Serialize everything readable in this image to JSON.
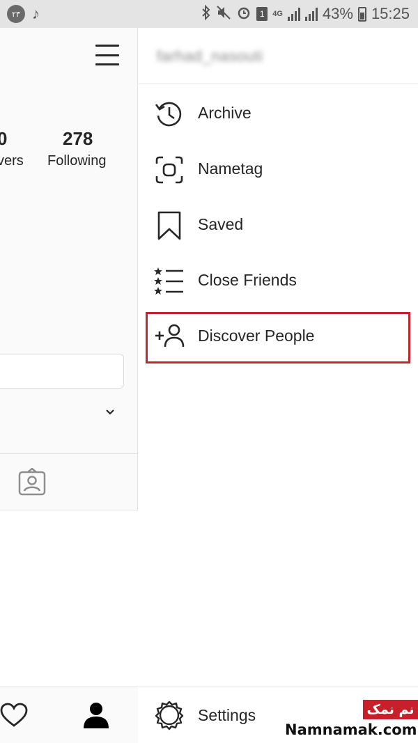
{
  "status_bar": {
    "left_badge": "۲۳",
    "sim": "1",
    "network": "4G",
    "battery_percent": "43%",
    "time": "15:25"
  },
  "profile": {
    "followers_count": "0",
    "followers_label": "vers",
    "following_count": "278",
    "following_label": "Following"
  },
  "menu": {
    "username": "farhad_nasouti",
    "items": [
      {
        "label": "Archive",
        "icon": "archive-icon"
      },
      {
        "label": "Nametag",
        "icon": "nametag-icon"
      },
      {
        "label": "Saved",
        "icon": "bookmark-icon"
      },
      {
        "label": "Close Friends",
        "icon": "close-friends-icon"
      },
      {
        "label": "Discover People",
        "icon": "add-person-icon"
      }
    ],
    "settings_label": "Settings"
  },
  "watermark": {
    "badge": "نم نمک",
    "site": "Namnamak.com"
  },
  "colors": {
    "highlight": "#c0262e",
    "text": "#262626"
  }
}
